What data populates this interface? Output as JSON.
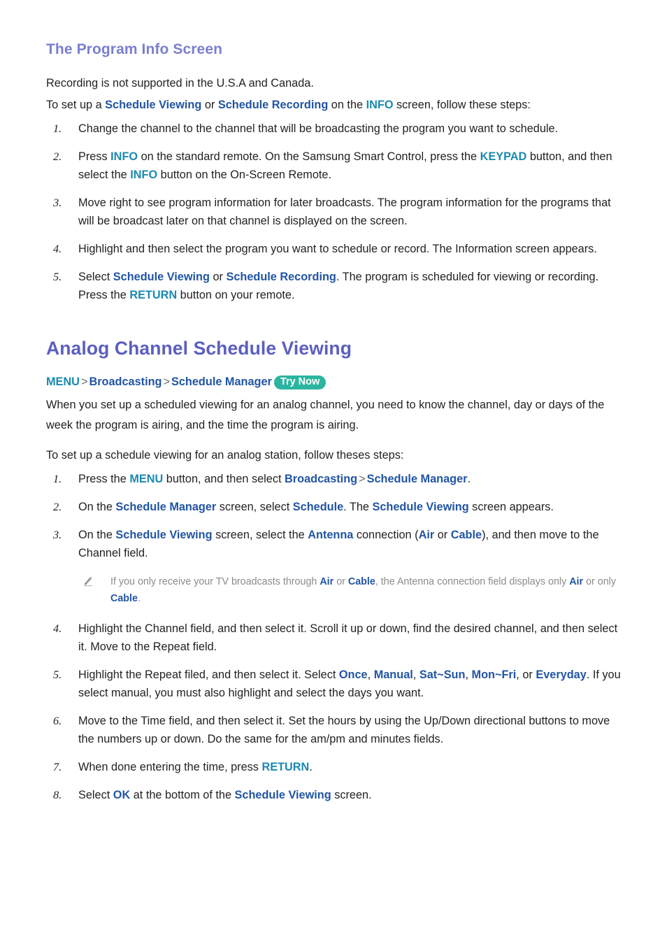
{
  "section1": {
    "heading": "The Program Info Screen",
    "intro1": "Recording is not supported in the U.S.A and Canada.",
    "intro2": {
      "a": "To set up a ",
      "link1": "Schedule Viewing",
      "b": " or ",
      "link2": "Schedule Recording",
      "c": " on the ",
      "btn1": "INFO",
      "d": " screen, follow these steps:"
    },
    "steps": {
      "s1": {
        "num": "1.",
        "text": "Change the channel to the channel that will be broadcasting the program you want to schedule."
      },
      "s2": {
        "num": "2.",
        "a": "Press ",
        "btn1": "INFO",
        "b": " on the standard remote. On the Samsung Smart Control, press the ",
        "btn2": "KEYPAD",
        "c": " button, and then select the ",
        "btn3": "INFO",
        "d": " button on the On-Screen Remote."
      },
      "s3": {
        "num": "3.",
        "text": "Move right to see program information for later broadcasts. The program information for the programs that will be broadcast later on that channel is displayed on the screen."
      },
      "s4": {
        "num": "4.",
        "text": "Highlight and then select the program you want to schedule or record. The Information screen appears."
      },
      "s5": {
        "num": "5.",
        "a": "Select ",
        "link1": "Schedule Viewing",
        "b": " or ",
        "link2": "Schedule Recording",
        "c": ". The program is scheduled for viewing or recording. Press the ",
        "btn1": "RETURN",
        "d": " button on your remote."
      }
    }
  },
  "section2": {
    "heading": "Analog Channel Schedule Viewing",
    "breadcrumb": {
      "item1": "MENU",
      "sep1": ">",
      "item2": "Broadcasting",
      "sep2": ">",
      "item3": "Schedule Manager",
      "badge": "Try Now"
    },
    "intro1": "When you set up a scheduled viewing for an analog channel, you need to know the channel, day or days of the week the program is airing, and the time the program is airing.",
    "intro2": "To set up a schedule viewing for an analog station, follow theses steps:",
    "steps": {
      "s1": {
        "num": "1.",
        "a": "Press the ",
        "btn1": "MENU",
        "b": " button, and then select ",
        "link1": "Broadcasting",
        "sep": ">",
        "link2": "Schedule Manager",
        "c": "."
      },
      "s2": {
        "num": "2.",
        "a": "On the ",
        "link1": "Schedule Manager",
        "b": " screen, select ",
        "link2": "Schedule",
        "c": ". The ",
        "link3": "Schedule Viewing",
        "d": " screen appears."
      },
      "s3": {
        "num": "3.",
        "a": "On the ",
        "link1": "Schedule Viewing",
        "b": " screen, select the ",
        "link2": "Antenna",
        "c": " connection (",
        "link3": "Air",
        "d": " or ",
        "link4": "Cable",
        "e": "), and then move to the Channel field."
      },
      "s4": {
        "num": "4.",
        "text": "Highlight the Channel field, and then select it. Scroll it up or down, find the desired channel, and then select it. Move to the Repeat field."
      },
      "s5": {
        "num": "5.",
        "a": "Highlight the Repeat filed, and then select it. Select ",
        "link1": "Once",
        "b": ", ",
        "link2": "Manual",
        "c": ", ",
        "link3": "Sat~Sun",
        "d": ", ",
        "link4": "Mon~Fri",
        "e": ", or ",
        "link5": "Everyday",
        "f": ". If you select manual, you must also highlight and select the days you want."
      },
      "s6": {
        "num": "6.",
        "text": "Move to the Time field, and then select it. Set the hours by using the Up/Down directional buttons to move the numbers up or down. Do the same for the am/pm and minutes fields."
      },
      "s7": {
        "num": "7.",
        "a": "When done entering the time, press ",
        "btn1": "RETURN",
        "b": "."
      },
      "s8": {
        "num": "8.",
        "a": "Select ",
        "link1": "OK",
        "b": " at the bottom of the ",
        "link2": "Schedule Viewing",
        "c": " screen."
      }
    },
    "note": {
      "icon": "pencil-icon",
      "a": "If you only receive your TV broadcasts through ",
      "b1": "Air",
      "b": " or ",
      "b2": "Cable",
      "c": ", the Antenna connection field displays only ",
      "b3": "Air",
      "d": " or only ",
      "b4": "Cable",
      "e": "."
    }
  }
}
